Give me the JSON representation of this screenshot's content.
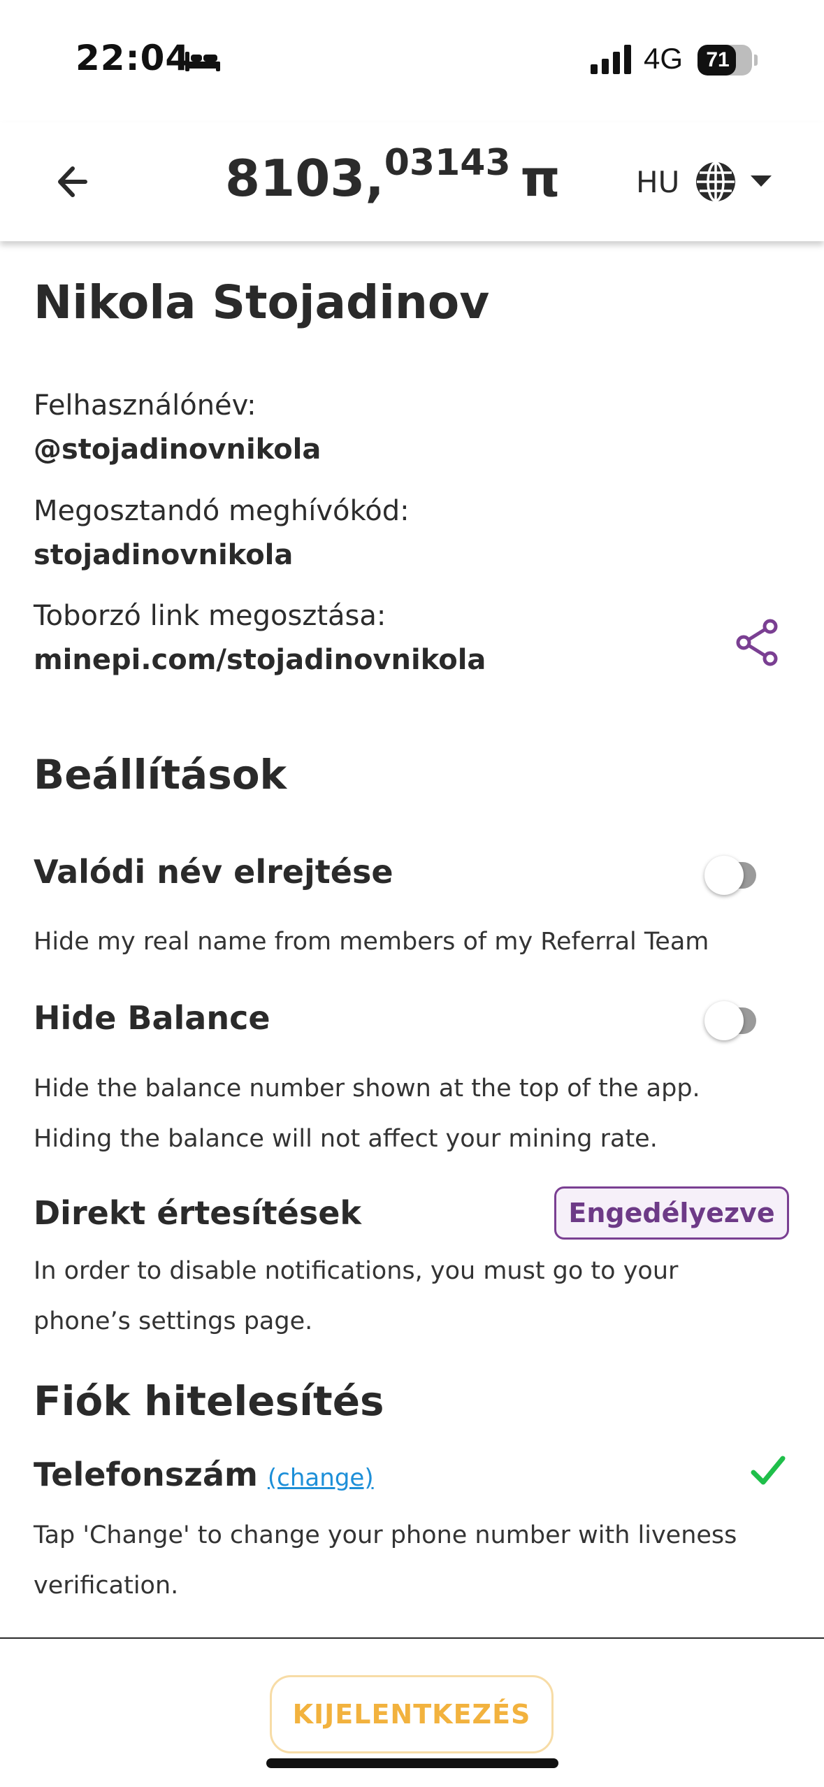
{
  "status_bar": {
    "time": "22:04",
    "network": "4G",
    "battery": "71",
    "battery_level": 0.71,
    "icons": [
      "bed-icon",
      "signal-bars-icon",
      "battery-icon"
    ]
  },
  "header": {
    "back_icon": "arrow-left-icon",
    "balance_integer": "8103,",
    "balance_decimals": "03143",
    "balance_symbol": "π",
    "language": "HU",
    "language_icons": [
      "globe-icon",
      "caret-down-icon"
    ]
  },
  "profile": {
    "name": "Nikola Stojadinov",
    "username_label": "Felhasználónév:",
    "username_value": "@stojadinovnikola",
    "invite_label": "Megosztandó meghívókód:",
    "invite_value": "stojadinovnikola",
    "link_label": "Toborzó link megosztása:",
    "link_value": "minepi.com/stojadinovnikola",
    "share_icon": "share-icon"
  },
  "settings": {
    "title": "Beállítások",
    "hide_name": {
      "title": "Valódi név elrejtése",
      "description": "Hide my real name from members of my Referral Team",
      "enabled": false
    },
    "hide_balance": {
      "title": "Hide Balance",
      "description": "Hide the balance number shown at the top of the app. Hiding the balance will not affect your mining rate.",
      "enabled": false
    },
    "notifications": {
      "title": "Direkt értesítések",
      "badge": "Engedélyezve",
      "description": "In order to disable notifications, you must go to your phone’s settings page."
    }
  },
  "verification": {
    "title": "Fiók hitelesítés",
    "phone_title": "Telefonszám",
    "change_link": "(change)",
    "description": "Tap 'Change' to change your phone number with liveness verification.",
    "verified": true
  },
  "footer": {
    "logout_label": "KIJELENTKEZÉS"
  },
  "colors": {
    "accent_purple": "#6d3a87",
    "link_blue": "#1d8fd8",
    "check_green": "#1fbf4a",
    "logout_orange": "#f2b23e"
  }
}
